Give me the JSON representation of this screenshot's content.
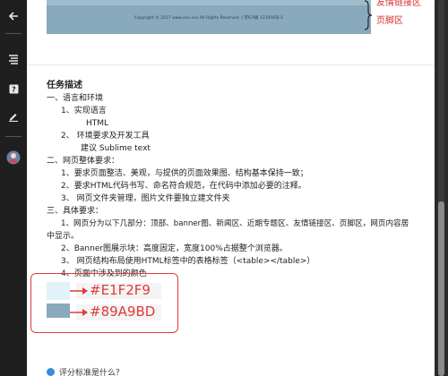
{
  "sidebar": {
    "icons": [
      "back-arrow-icon",
      "menu-icon",
      "help-icon",
      "edit-icon",
      "avatar"
    ]
  },
  "footer_preview": {
    "copyright": "Copyright © 2017 www.xxx.xxx All Rights Reserved. | 苏ICP备 123456号-1",
    "label": "页脚区",
    "top_label": "友情链接区",
    "bg_color": "#89A9BD"
  },
  "task": {
    "title": "任务描述",
    "lines": [
      "一、语言和环境",
      "1、实现语言",
      "HTML",
      "2、 环境要求及开发工具",
      "建议 Sublime text",
      "二、网页整体要求：",
      "1、要求页面整洁、美观，与提供的页面效果图、结构基本保持一致；",
      "2、要求HTML代码书写、命名符合规范，在代码中添加必要的注释。",
      "3、 网页文件夹管理，图片文件要独立建文件夹",
      "三、具体要求：",
      "1、网页分为以下几部分：顶部、banner图、新闻区、近期专题区、友情链接区、页脚区，网页内容居",
      "中显示。",
      "2、Banner图展示块：高度固定，宽度100%占据整个浏览器。",
      "3、 网页结构布局使用HTML标签中的表格标签（<table></table>）",
      "4、页面中涉及到的颜色"
    ]
  },
  "colors": {
    "color1": "#E1F2F9",
    "color2": "#89A9BD",
    "accent": "#E23A3A"
  },
  "bottom": {
    "item": "评分标准是什么？"
  }
}
